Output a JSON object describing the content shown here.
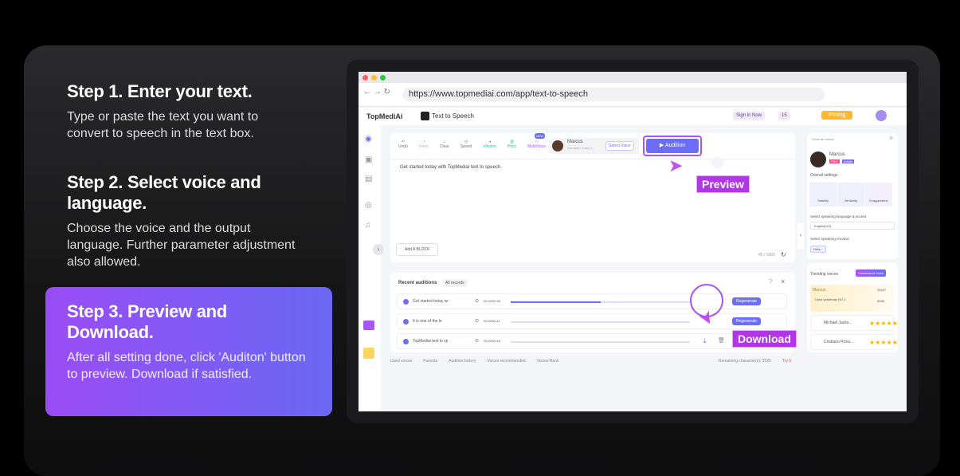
{
  "steps": [
    {
      "title": "Step 1. Enter your text.",
      "desc": "Type or paste the text you want to convert to speech in the text box."
    },
    {
      "title": "Step 2. Select voice and language.",
      "desc": "Choose the voice and the output language. Further parameter adjustment also allowed."
    },
    {
      "title": "Step 3. Preview and Download.",
      "desc": "After all setting done, click 'Auditon' button to preview. Download if satisfied."
    }
  ],
  "browser": {
    "url": "https://www.topmediai.com/app/text-to-speech"
  },
  "app": {
    "logo": "TopMediAi",
    "page_title": "Text to Speech",
    "sign_in": "Sign in Now",
    "coins": "15",
    "pricing": "Pricing"
  },
  "toolbar": {
    "undo": "Undo",
    "redo": "Redo",
    "clear": "Clear",
    "speed": "Speed",
    "volume": "Volume",
    "pitch": "Pitch",
    "multivoice": "MultiVoice",
    "new_badge": "NEW",
    "voice_name": "Marcus",
    "voice_desc": "Narration, Deep v...",
    "select_voice": "Select Voice",
    "audition": "▶ Audition"
  },
  "editor": {
    "text": "Get started today with TopMediai text to speech.",
    "add_block": "Add A BLOCK",
    "count": "45 / 1000"
  },
  "callouts": {
    "preview": "Preview",
    "download": "Download"
  },
  "recent": {
    "title": "Recent auditions",
    "all": "All records",
    "rows": [
      {
        "text": "Get started today wi",
        "time": "00:02/00:03",
        "progress": 0.5
      },
      {
        "text": "It is one of the le",
        "time": "00:00/00:11",
        "progress": 0
      },
      {
        "text": "TopMediai text to sp",
        "time": "00:00/00:18",
        "progress": 0
      }
    ],
    "regenerate": "Regenerate"
  },
  "footer": {
    "links": [
      "Used voices",
      "Favorite",
      "Audition history",
      "Voices recommended",
      "Voices Rank"
    ],
    "remaining": "Remaining character(s): 2525",
    "tag": "Try it"
  },
  "right": {
    "show_all": "Show all voices",
    "name": "Marcus",
    "badges": [
      "PRO",
      "Adults"
    ],
    "overall": "Overall settings",
    "settings": [
      "Stability",
      "Similarity",
      "Exaggeration"
    ],
    "lang_label": "Select speaking language & accent",
    "lang": "English(US)",
    "emotion_label": "Select speaking emotion",
    "emotion": "Defa...",
    "trending": "Trending voices",
    "custom": "Customized Voice",
    "voices": [
      {
        "name": "Marcus",
        "sub": "Used yesterday NO.1",
        "s1": "25447",
        "s2": "6536",
        "u": "Users"
      },
      {
        "name": "Michael Jacks..."
      },
      {
        "name": "Cristiano Rona..."
      }
    ],
    "stars": "★★★★★"
  }
}
